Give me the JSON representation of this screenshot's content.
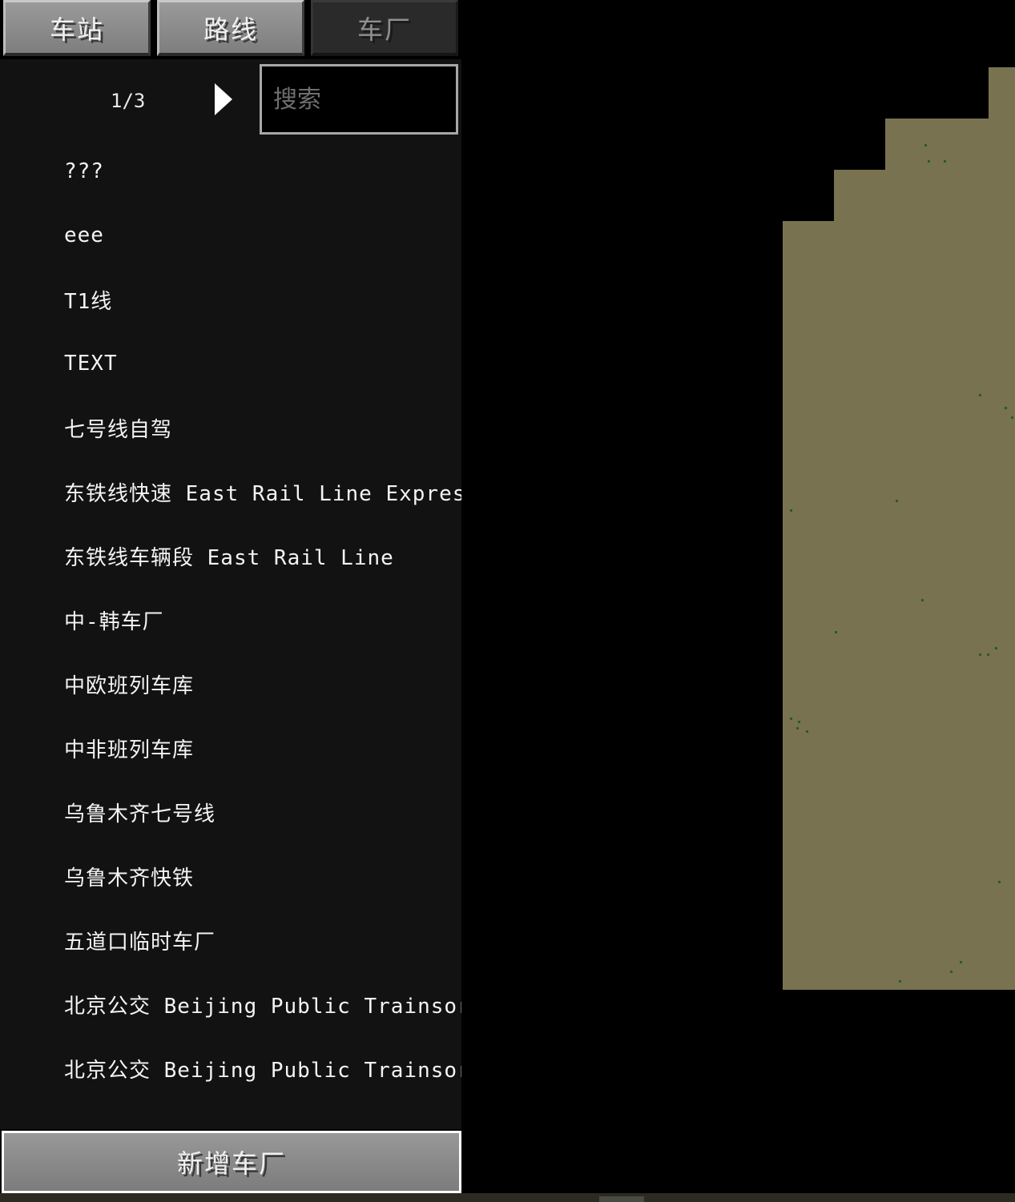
{
  "tabs": [
    {
      "label": "车站",
      "state": "active"
    },
    {
      "label": "路线",
      "state": "active"
    },
    {
      "label": "车厂",
      "state": "inactive"
    }
  ],
  "pager": {
    "text": "1/3"
  },
  "search": {
    "placeholder": "搜索",
    "value": ""
  },
  "list": {
    "items": [
      {
        "label": "???"
      },
      {
        "label": "eee"
      },
      {
        "label": "T1线"
      },
      {
        "label": "TEXT"
      },
      {
        "label": "七号线自驾"
      },
      {
        "label": "东铁线快速 East Rail Line Express"
      },
      {
        "label": "东铁线车辆段 East Rail Line"
      },
      {
        "label": "中-韩车厂"
      },
      {
        "label": "中欧班列车库"
      },
      {
        "label": "中非班列车库"
      },
      {
        "label": "乌鲁木齐七号线"
      },
      {
        "label": "乌鲁木齐快铁"
      },
      {
        "label": "五道口临时车厂"
      },
      {
        "label": "北京公交 Beijing Public Trainsort"
      },
      {
        "label": "北京公交 Beijing Public Trainsort"
      }
    ]
  },
  "add_button": {
    "label": "新增车厂"
  },
  "colors": {
    "terrain": "#787250",
    "panel": "#121212",
    "vegetation": "#2e5a1e"
  }
}
